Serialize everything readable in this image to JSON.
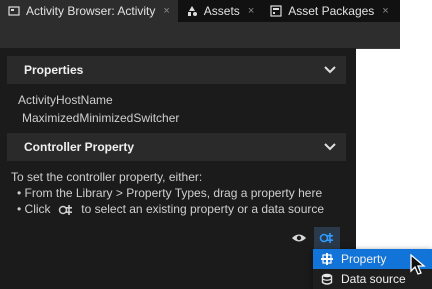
{
  "tabs": [
    {
      "label": "Activity Browser: Activity",
      "icon": "activity-browser-icon",
      "active": true,
      "close": "×"
    },
    {
      "label": "Assets",
      "icon": "assets-icon",
      "active": false,
      "close": "×"
    },
    {
      "label": "Asset Packages",
      "icon": "asset-packages-icon",
      "active": false,
      "close": "×"
    }
  ],
  "properties": {
    "title": "Properties",
    "items": [
      "ActivityHostName",
      "MaximizedMinimizedSwitcher"
    ]
  },
  "controller": {
    "title": "Controller Property",
    "intro": "To set the controller property, either:",
    "bullet1": "• From the Library > Property Types, drag a property here",
    "bullet2_pre": "• Click",
    "bullet2_post": "to select an existing property or a data source"
  },
  "menu": {
    "items": [
      {
        "label": "Property",
        "icon": "property-icon",
        "highlighted": true
      },
      {
        "label": "Data source",
        "icon": "database-icon",
        "highlighted": false
      }
    ]
  },
  "colors": {
    "accent": "#1273d8",
    "panel": "#1b1b1b",
    "header": "#2a2a2a"
  }
}
